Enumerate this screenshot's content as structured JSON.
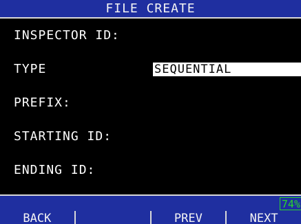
{
  "title": "FILE CREATE",
  "fields": [
    {
      "label": "INSPECTOR ID:",
      "value": ""
    },
    {
      "label": "TYPE",
      "value": "SEQUENTIAL"
    },
    {
      "label": "PREFIX:",
      "value": ""
    },
    {
      "label": "STARTING ID:",
      "value": ""
    },
    {
      "label": "ENDING ID:",
      "value": ""
    }
  ],
  "status": {
    "battery": "74%"
  },
  "softkeys": [
    "BACK",
    "",
    "PREV",
    "NEXT"
  ],
  "colors": {
    "bar_blue": "#1f2fa0",
    "battery_green": "#2bd62b",
    "background": "#000000",
    "highlight": "#ffffff"
  }
}
